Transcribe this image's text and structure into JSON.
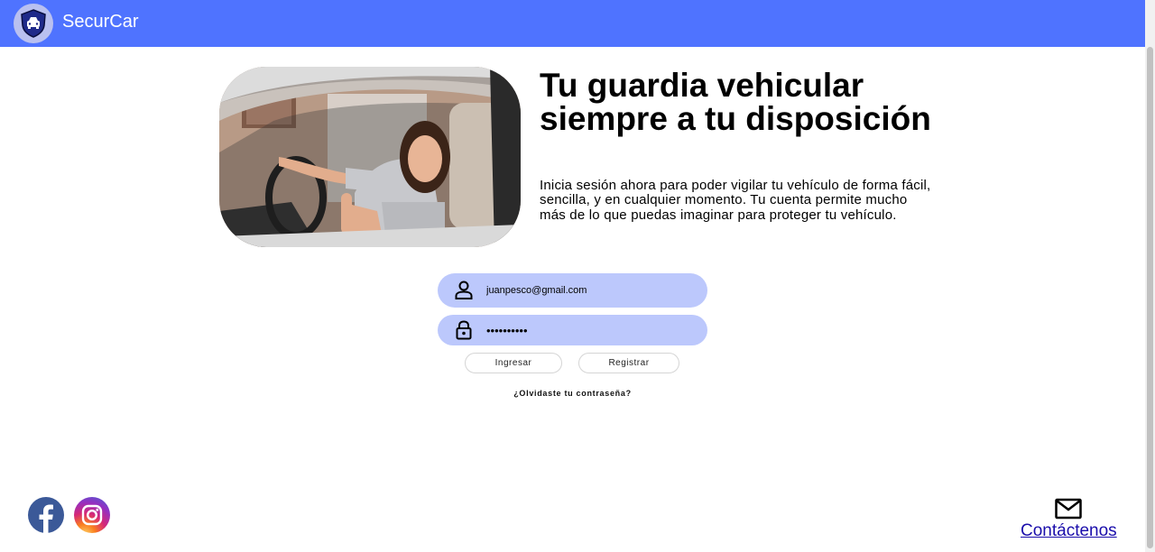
{
  "header": {
    "brand": "SecurCar",
    "logo_icon": "car-shield-icon",
    "background_color": "#4f73ff"
  },
  "hero": {
    "image_description_icon": "woman-driving-car-photo",
    "title": "Tu guardia vehicular siempre a tu disposición",
    "description": "Inicia sesión ahora para poder vigilar tu vehículo de forma fácil, sencilla, y en cualquier momento. Tu cuenta permite mucho más de lo que puedas imaginar para proteger tu vehículo."
  },
  "login": {
    "email_value": "juanpesco@gmail.com",
    "email_icon": "user-icon",
    "password_value": "••••••••••",
    "password_icon": "lock-icon",
    "login_label": "Ingresar",
    "register_label": "Registrar",
    "forgot_label": "¿Olvidaste tu contraseña?",
    "field_color": "#bcc8fc"
  },
  "footer": {
    "social": [
      {
        "icon": "facebook-icon"
      },
      {
        "icon": "instagram-icon"
      }
    ],
    "contact_icon": "mail-icon",
    "contact_label": "Contáctenos"
  }
}
